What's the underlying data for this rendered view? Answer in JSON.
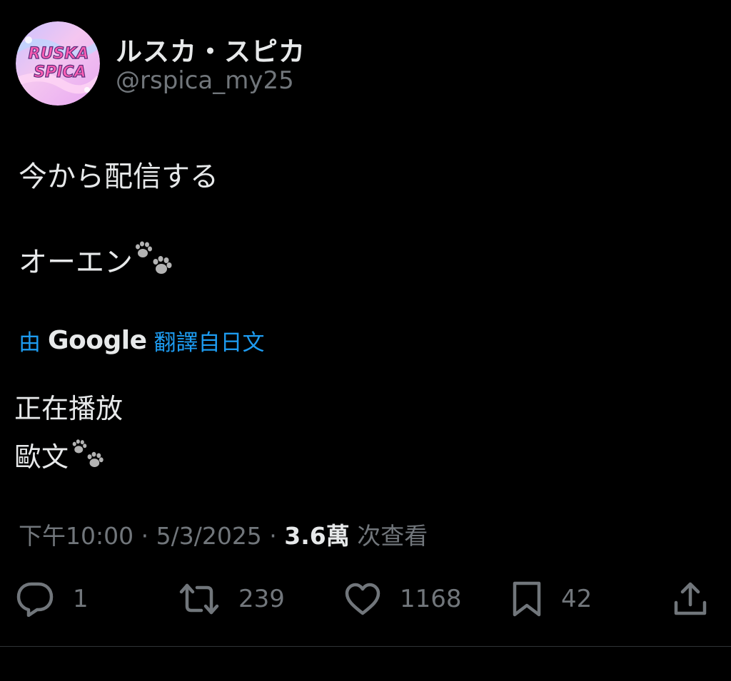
{
  "author": {
    "display_name": "ルスカ・スピカ",
    "handle": "@rspica_my25",
    "avatar_text_line1": "RUSKA",
    "avatar_text_line2": "SPICA"
  },
  "tweet": {
    "line1": "今から配信する",
    "line2": "オーエン",
    "line2_emoji": "paw-prints-icon"
  },
  "translation": {
    "prefix": "由",
    "provider": "Google",
    "suffix": "翻譯自日文",
    "line1": "正在播放",
    "line2": "歐文",
    "line2_emoji": "paw-prints-icon"
  },
  "meta": {
    "time": "下午10:00",
    "separator": " · ",
    "date": "5/3/2025",
    "views_count": "3.6萬",
    "views_label": " 次查看"
  },
  "actions": {
    "reply_count": "1",
    "retweet_count": "239",
    "like_count": "1168",
    "bookmark_count": "42"
  },
  "colors": {
    "background": "#000000",
    "text": "#e7e9ea",
    "muted": "#71767b",
    "link": "#1d9bf0"
  }
}
